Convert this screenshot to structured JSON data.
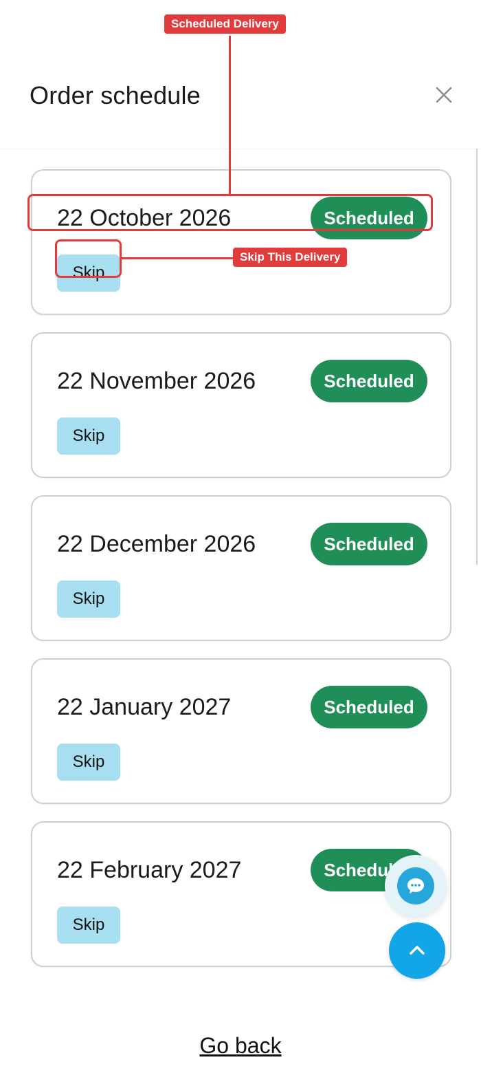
{
  "header": {
    "title": "Order schedule",
    "close_icon": "close-icon"
  },
  "deliveries": [
    {
      "date": "22 October 2026",
      "status": "Scheduled",
      "skip_label": "Skip"
    },
    {
      "date": "22 November 2026",
      "status": "Scheduled",
      "skip_label": "Skip"
    },
    {
      "date": "22 December 2026",
      "status": "Scheduled",
      "skip_label": "Skip"
    },
    {
      "date": "22 January 2027",
      "status": "Scheduled",
      "skip_label": "Skip"
    },
    {
      "date": "22 February 2027",
      "status": "Scheduled",
      "skip_label": "Skip"
    }
  ],
  "footer": {
    "go_back": "Go back"
  },
  "annotations": {
    "scheduled_delivery": "Scheduled Delivery",
    "skip_this_delivery": "Skip This Delivery"
  },
  "colors": {
    "status_green": "#1f8e57",
    "skip_blue": "#a7dff0",
    "fab_blue": "#12a5e8",
    "annotation_red": "#e23b3b"
  },
  "icons": {
    "chat": "chat-bubble-icon",
    "scroll_top": "chevron-up-icon"
  }
}
